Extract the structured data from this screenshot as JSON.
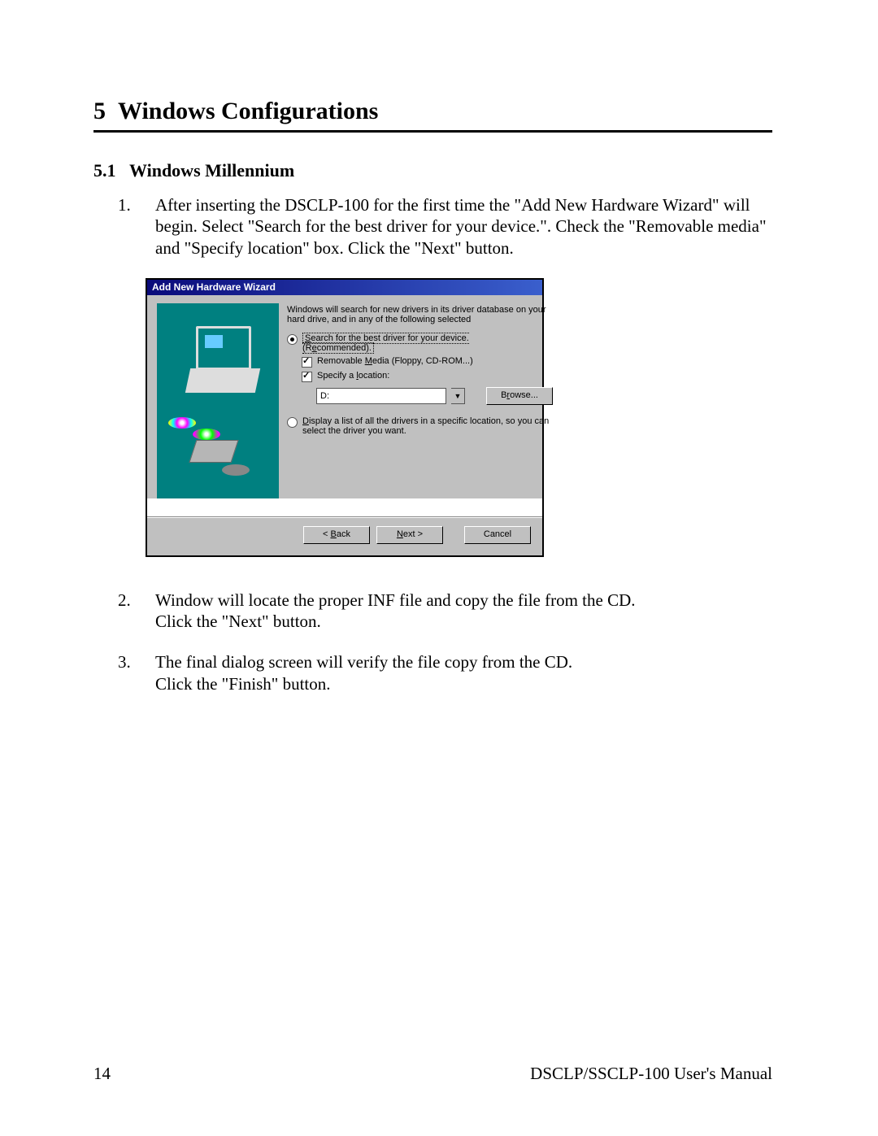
{
  "chapter": {
    "number": "5",
    "title": "Windows Configurations"
  },
  "section": {
    "number": "5.1",
    "title": "Windows Millennium"
  },
  "steps": {
    "s1": {
      "n": "1.",
      "text": "After inserting the DSCLP-100 for the first time the \"Add New Hardware Wizard\" will begin.  Select \"Search for the best driver for your device.\". Check the \"Removable media\" and \"Specify location\" box. Click the \"Next\" button."
    },
    "s2": {
      "n": "2.",
      "line1": "Window will locate the proper INF file and copy the file from the CD.",
      "line2": "Click the \"Next\" button."
    },
    "s3": {
      "n": "3.",
      "line1": "The final dialog screen will verify the file copy from the CD.",
      "line2": "Click the \"Finish\" button."
    }
  },
  "wizard": {
    "title": "Add New Hardware Wizard",
    "intro": "Windows will search for new drivers in its driver database on your hard drive, and in any of the following selected",
    "opt_search_pre": "S",
    "opt_search_rest": "earch for the best driver for your device.",
    "opt_search_sub_pre": "(R",
    "opt_search_sub_u": "e",
    "opt_search_sub_post": "commended).",
    "chk_removable_pre": "Removable ",
    "chk_removable_u": "M",
    "chk_removable_post": "edia (Floppy, CD-ROM...)",
    "chk_specify_pre": "Specify a ",
    "chk_specify_u": "l",
    "chk_specify_post": "ocation:",
    "location_value": "D:",
    "browse_pre": "B",
    "browse_u": "r",
    "browse_post": "owse...",
    "opt_list_pre": "D",
    "opt_list_rest": "isplay a list of all the drivers in a specific location, so you can select the driver you want.",
    "btn_back_pre": "< ",
    "btn_back_u": "B",
    "btn_back_post": "ack",
    "btn_next_pre": "N",
    "btn_next_rest": "ext >",
    "btn_cancel": "Cancel"
  },
  "footer": {
    "page_no": "14",
    "doc_title": "DSCLP/SSCLP-100 User's Manual"
  }
}
